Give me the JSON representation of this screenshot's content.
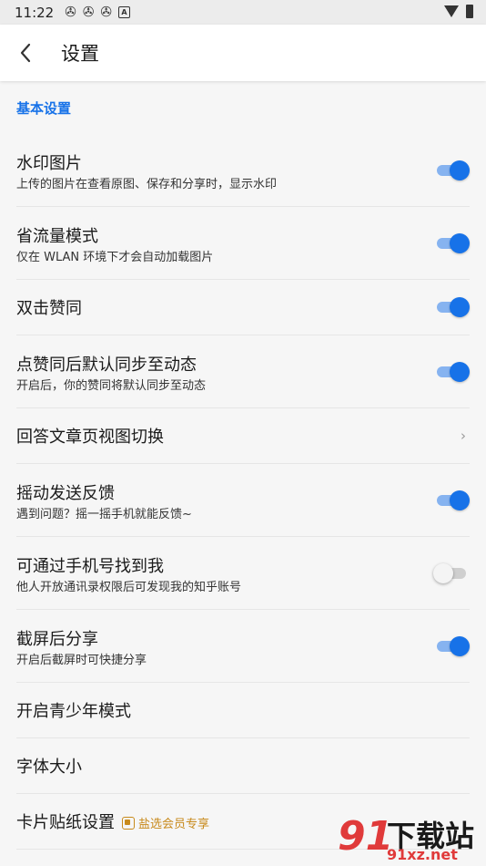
{
  "status_bar": {
    "time": "11:22",
    "notification_icons": [
      "pinwheel-icon",
      "pinwheel-icon",
      "pinwheel-icon",
      "a-icon"
    ],
    "right_icons": [
      "wifi-icon",
      "battery-icon"
    ]
  },
  "app_bar": {
    "title": "设置"
  },
  "section": {
    "label": "基本设置",
    "accent_color": "#1772e8"
  },
  "settings": [
    {
      "title": "水印图片",
      "subtitle": "上传的图片在查看原图、保存和分享时，显示水印",
      "control": "toggle",
      "on": true
    },
    {
      "title": "省流量模式",
      "subtitle": "仅在 WLAN 环境下才会自动加载图片",
      "control": "toggle",
      "on": true
    },
    {
      "title": "双击赞同",
      "subtitle": "",
      "control": "toggle",
      "on": true
    },
    {
      "title": "点赞同后默认同步至动态",
      "subtitle": "开启后，你的赞同将默认同步至动态",
      "control": "toggle",
      "on": true
    },
    {
      "title": "回答文章页视图切换",
      "subtitle": "",
      "control": "chevron",
      "chevron": "›"
    },
    {
      "title": "摇动发送反馈",
      "subtitle": "遇到问题？摇一摇手机就能反馈~",
      "control": "toggle",
      "on": true
    },
    {
      "title": "可通过手机号找到我",
      "subtitle": "他人开放通讯录权限后可发现我的知乎账号",
      "control": "toggle",
      "on": false
    },
    {
      "title": "截屏后分享",
      "subtitle": "开启后截屏时可快捷分享",
      "control": "toggle",
      "on": true
    },
    {
      "title": "开启青少年模式",
      "subtitle": "",
      "control": "none"
    },
    {
      "title": "字体大小",
      "subtitle": "",
      "control": "none"
    },
    {
      "title": "卡片贴纸设置",
      "subtitle": "",
      "control": "none",
      "badge": "盐选会员专享"
    }
  ],
  "watermark": {
    "number": "91",
    "title": "下载站",
    "site": "91xz.net"
  }
}
